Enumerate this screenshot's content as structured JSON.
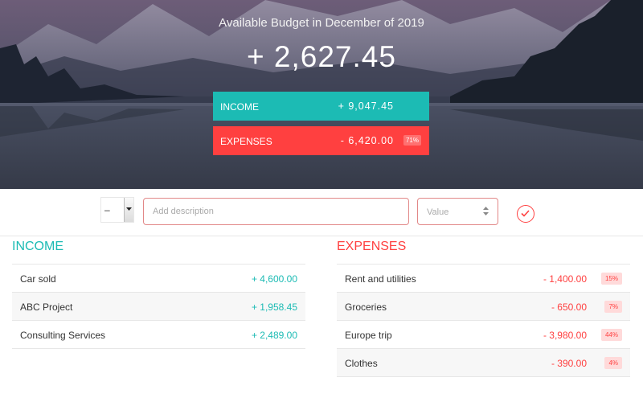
{
  "budget": {
    "title": "Available Budget in December of 2019",
    "value": "+ 2,627.45",
    "income_label": "Income",
    "income_value": "+ 9,047.45",
    "expenses_label": "Expenses",
    "expenses_value": "- 6,420.00",
    "expenses_percentage": "71%"
  },
  "add": {
    "type_value": "–",
    "description_placeholder": "Add description",
    "value_placeholder": "Value",
    "submit_icon": "check-circle-icon"
  },
  "income": {
    "title": "Income",
    "items": [
      {
        "description": "Car sold",
        "value": "+ 4,600.00"
      },
      {
        "description": "ABC Project",
        "value": "+ 1,958.45"
      },
      {
        "description": "Consulting Services",
        "value": "+ 2,489.00"
      }
    ]
  },
  "expenses": {
    "title": "Expenses",
    "items": [
      {
        "description": "Rent and utilities",
        "value": "- 1,400.00",
        "percentage": "15%"
      },
      {
        "description": "Groceries",
        "value": "- 650.00",
        "percentage": "7%"
      },
      {
        "description": "Europe trip",
        "value": "- 3,980.00",
        "percentage": "44%"
      },
      {
        "description": "Clothes",
        "value": "- 390.00",
        "percentage": "4%"
      }
    ]
  },
  "colors": {
    "income": "#1cbbb4",
    "expenses": "#ff4040"
  }
}
